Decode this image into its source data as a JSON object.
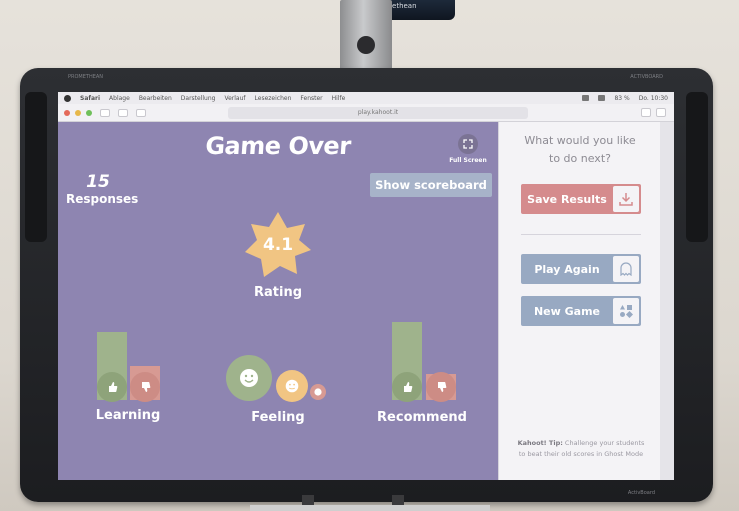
{
  "projector": {
    "label": "✕ Promethean"
  },
  "board": {
    "brand_left": "PROMETHEAN",
    "brand_right": "ACTIVBOARD",
    "brand_bottom": "ActivBoard"
  },
  "menubar": {
    "items": [
      "Safari",
      "Ablage",
      "Bearbeiten",
      "Darstellung",
      "Verlauf",
      "Lesezeichen",
      "Fenster",
      "Hilfe"
    ],
    "battery": "83 %",
    "clock": "Do. 10:30"
  },
  "browser": {
    "url": "play.kahoot.it"
  },
  "game": {
    "title": "Game Over",
    "fullscreen_label": "Full Screen",
    "responses_count": "15",
    "responses_label": "Responses",
    "scoreboard_button": "Show scoreboard",
    "rating_value": "4.1",
    "rating_label": "Rating",
    "stats": {
      "learning": {
        "label": "Learning",
        "positive_ratio": 0.8,
        "negative_ratio": 0.4
      },
      "feeling": {
        "label": "Feeling"
      },
      "recommend": {
        "label": "Recommend",
        "positive_ratio": 0.92,
        "negative_ratio": 0.3
      }
    }
  },
  "panel": {
    "question_line1": "What would you like",
    "question_line2": "to do next?",
    "save_results": "Save Results",
    "play_again": "Play Again",
    "new_game": "New Game",
    "tip_title": "Kahoot! Tip:",
    "tip_text": "Challenge your students to beat their old scores in Ghost Mode"
  },
  "colors": {
    "game_bg": "#8e85b1",
    "positive": "#9fb38c",
    "negative": "#d79a93",
    "star": "#f1c583",
    "save_btn": "#d58b8d",
    "action_btn": "#98a9c2"
  },
  "icons": [
    "fullscreen-icon",
    "download-icon",
    "ghost-icon",
    "shapes-icon",
    "thumbs-up-icon",
    "thumbs-down-icon",
    "smile-icon",
    "neutral-icon",
    "sad-icon"
  ]
}
